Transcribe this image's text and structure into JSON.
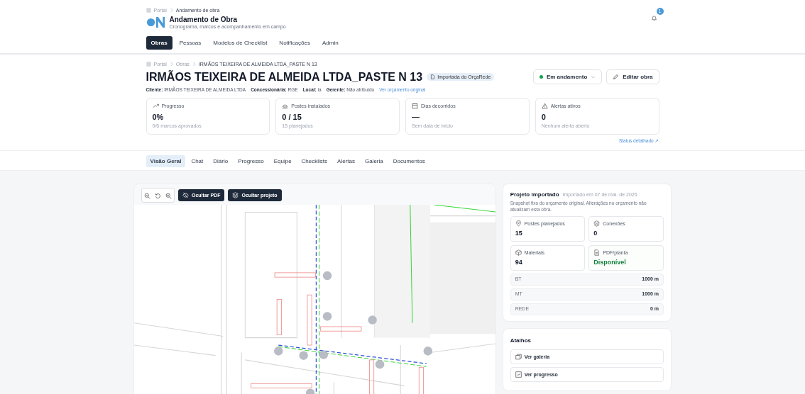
{
  "app_header": {
    "breadcrumb": [
      "Portal",
      "Andamento de obra"
    ],
    "title": "Andamento de Obra",
    "subtitle": "Cronograma, marcos e acompanhamento em campo",
    "notifications_badge": "1",
    "nav": [
      {
        "label": "Obras",
        "selected": true
      },
      {
        "label": "Pessoas",
        "selected": false
      },
      {
        "label": "Modelos de Checklist",
        "selected": false
      },
      {
        "label": "Notificações",
        "selected": false
      },
      {
        "label": "Admin",
        "selected": false
      }
    ]
  },
  "project": {
    "breadcrumb": [
      "Portal",
      "Obras",
      "IRMÃOS TEIXEIRA DE ALMEIDA LTDA_PASTE N 13"
    ],
    "title": "IRMÃOS TEIXEIRA DE ALMEIDA LTDA_PASTE N 13",
    "badge": "Importada do OrçaRede",
    "status": {
      "label": "Em andamento",
      "color": "#16a34a"
    },
    "edit_button": "Editar obra",
    "meta": [
      {
        "label": "Cliente:",
        "value": "IRMÃOS TEIXEIRA DE ALMEIDA LTDA"
      },
      {
        "label": "Concessionária:",
        "value": "RGE"
      },
      {
        "label": "Local:",
        "value": "la"
      },
      {
        "label": "Gerente:",
        "value": "Não atribuído"
      }
    ],
    "meta_link": "Ver orçamento original",
    "stats": [
      {
        "kind": "trend",
        "label": "Progresso",
        "value": "0%",
        "note": "0/6 marcos aprovados"
      },
      {
        "kind": "pole",
        "label": "Postes instalados",
        "value": "0 / 15",
        "note": "15 planejados"
      },
      {
        "kind": "calendar",
        "label": "Dias decorridos",
        "value": "—",
        "note": "Sem data de início"
      },
      {
        "kind": "alert",
        "label": "Alertas ativos",
        "value": "0",
        "note": "Nenhum alerta aberto"
      }
    ],
    "status_link": "Status detalhado ↗"
  },
  "tabs": [
    {
      "label": "Visão Geral",
      "selected": true
    },
    {
      "label": "Chat",
      "selected": false
    },
    {
      "label": "Diário",
      "selected": false
    },
    {
      "label": "Progresso",
      "selected": false
    },
    {
      "label": "Equipe",
      "selected": false
    },
    {
      "label": "Checklists",
      "selected": false
    },
    {
      "label": "Alertas",
      "selected": false
    },
    {
      "label": "Galeria",
      "selected": false
    },
    {
      "label": "Documentos",
      "selected": false
    }
  ],
  "viewer": {
    "buttons": [
      {
        "kind": "hide-pdf",
        "label": "Ocultar PDF"
      },
      {
        "kind": "hide-layers",
        "label": "Ocultar projeto"
      }
    ]
  },
  "imported": {
    "title": "Projeto importado",
    "date": "Importado em 07 de mai. de 2026",
    "description": "Snapshot fixo do orçamento original. Alterações no orçamento não atualizam esta obra.",
    "cards": [
      {
        "kind": "pin",
        "label": "Postes planejados",
        "value": "15",
        "highlight": false
      },
      {
        "kind": "layers",
        "label": "Conexões",
        "value": "0",
        "highlight": false
      },
      {
        "kind": "box",
        "label": "Materiais",
        "value": "94",
        "highlight": false
      },
      {
        "kind": "file",
        "label": "PDF/planta",
        "value": "Disponível",
        "highlight": true
      }
    ],
    "lengths": [
      {
        "label": "BT",
        "value": "1000 m"
      },
      {
        "label": "MT",
        "value": "1000 m"
      },
      {
        "label": "REDE",
        "value": "0 m"
      }
    ]
  },
  "shortcuts": {
    "title": "Atalhos",
    "items": [
      {
        "kind": "gallery",
        "label": "Ver galeria"
      },
      {
        "kind": "progress",
        "label": "Ver progresso"
      }
    ]
  }
}
